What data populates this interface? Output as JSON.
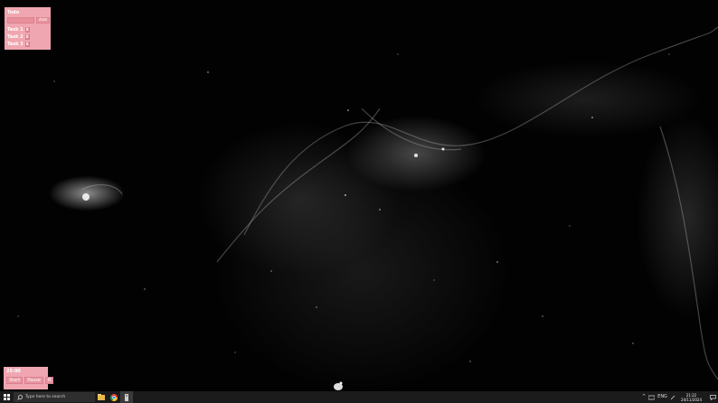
{
  "todo": {
    "title": "Todo",
    "input_placeholder": "",
    "add_label": "Add",
    "tasks": [
      {
        "label": "Task 1",
        "delete_label": "X"
      },
      {
        "label": "Task 2",
        "delete_label": "X"
      },
      {
        "label": "Task 3",
        "delete_label": "X"
      }
    ]
  },
  "timer": {
    "display": "25:00",
    "start_label": "Start",
    "pause_label": "Pause",
    "reset_label": "R"
  },
  "taskbar": {
    "search_placeholder": "Type here to search",
    "apps": [
      "file-explorer-icon",
      "chrome-icon",
      "app-icon"
    ],
    "tray": {
      "chevron": "^",
      "language": "ENG"
    },
    "clock": {
      "time": "21:22",
      "date": "24/11/2024"
    }
  },
  "colors": {
    "widget_bg": "#f0a6b0",
    "taskbar_bg": "#1b1b1b"
  }
}
